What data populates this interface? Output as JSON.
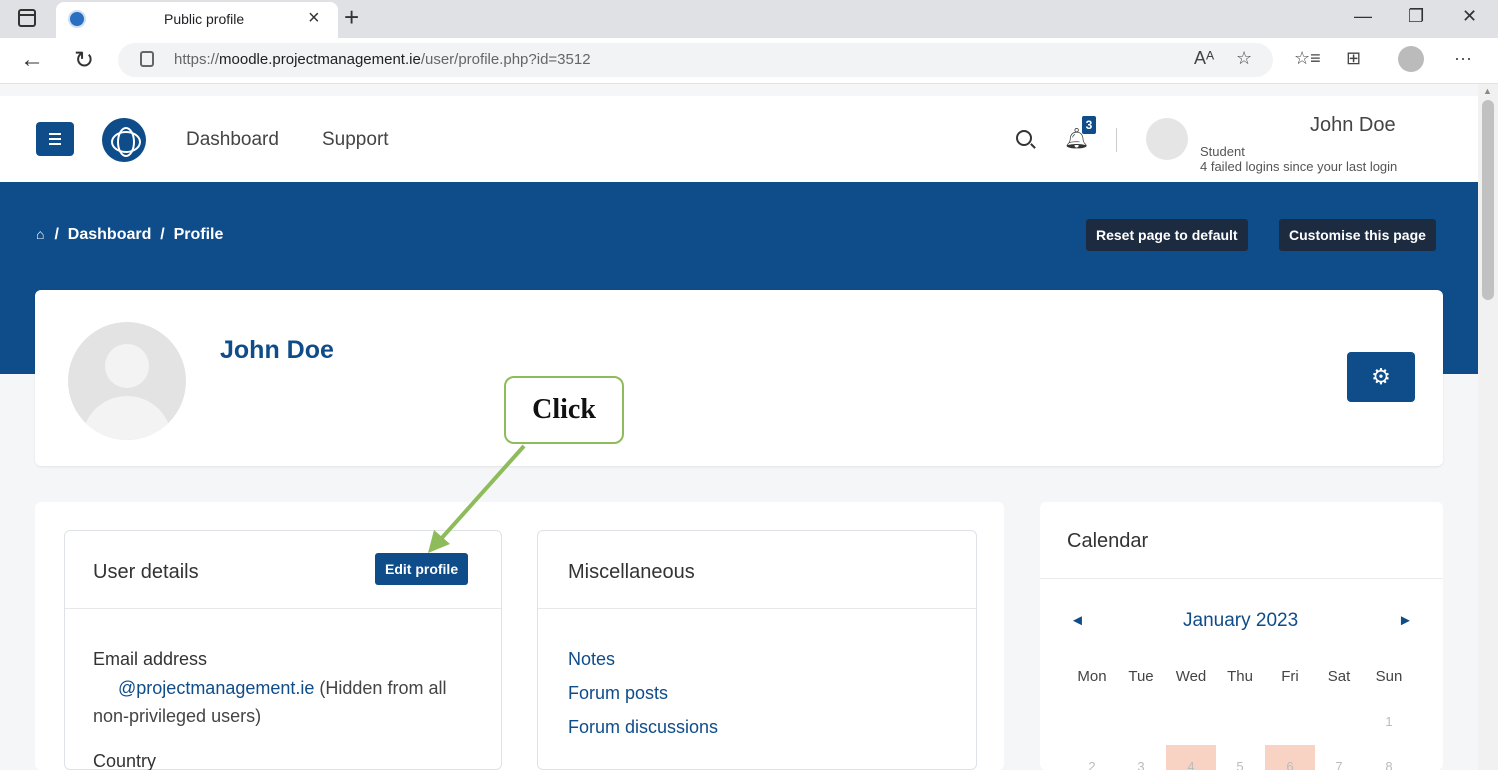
{
  "browser": {
    "tab_title": "Public profile",
    "tab_close": "×",
    "new_tab": "+",
    "url_prefix": "https://",
    "url_host": "moodle.projectmanagement.ie",
    "url_path": "/user/profile.php?id=3512",
    "win_minimize": "—",
    "win_maximize": "❐",
    "win_close": "✕",
    "back": "←",
    "reload": "↻",
    "read_aloud": "Aᴬ",
    "add_favorite": "☆",
    "favorites": "☆≡",
    "collections": "⊞",
    "more": "···"
  },
  "navbar": {
    "links": [
      "Dashboard",
      "Support"
    ],
    "notification_count": "3",
    "user_name": "John Doe",
    "user_role": "Student",
    "failed_logins": "4 failed logins since your last login"
  },
  "header": {
    "breadcrumb": [
      "Dashboard",
      "Profile"
    ],
    "breadcrumb_sep": "/",
    "reset_button": "Reset page to default",
    "customise_button": "Customise this page"
  },
  "profile": {
    "name": "John Doe",
    "gear": "⚙"
  },
  "user_details": {
    "title": "User details",
    "edit_button": "Edit profile",
    "email_label": "Email address",
    "email_value": "@projectmanagement.ie",
    "email_note": "(Hidden from all non-privileged users)",
    "country_label": "Country"
  },
  "misc": {
    "title": "Miscellaneous",
    "links": [
      "Notes",
      "Forum posts",
      "Forum discussions"
    ]
  },
  "calendar": {
    "title": "Calendar",
    "prev": "◄",
    "next": "►",
    "month": "January 2023",
    "days": [
      "Mon",
      "Tue",
      "Wed",
      "Thu",
      "Fri",
      "Sat",
      "Sun"
    ],
    "week1": [
      "",
      "",
      "",
      "",
      "",
      "",
      "1"
    ],
    "week2": [
      "2",
      "3",
      "4",
      "5",
      "6",
      "7",
      "8"
    ]
  },
  "annotation": {
    "callout": "Click",
    "color": "#8ebc5b"
  },
  "colors": {
    "brand": "#0f4c8a",
    "header_button": "#1c2b3f",
    "calendar_highlight": "#f8d3c4"
  }
}
